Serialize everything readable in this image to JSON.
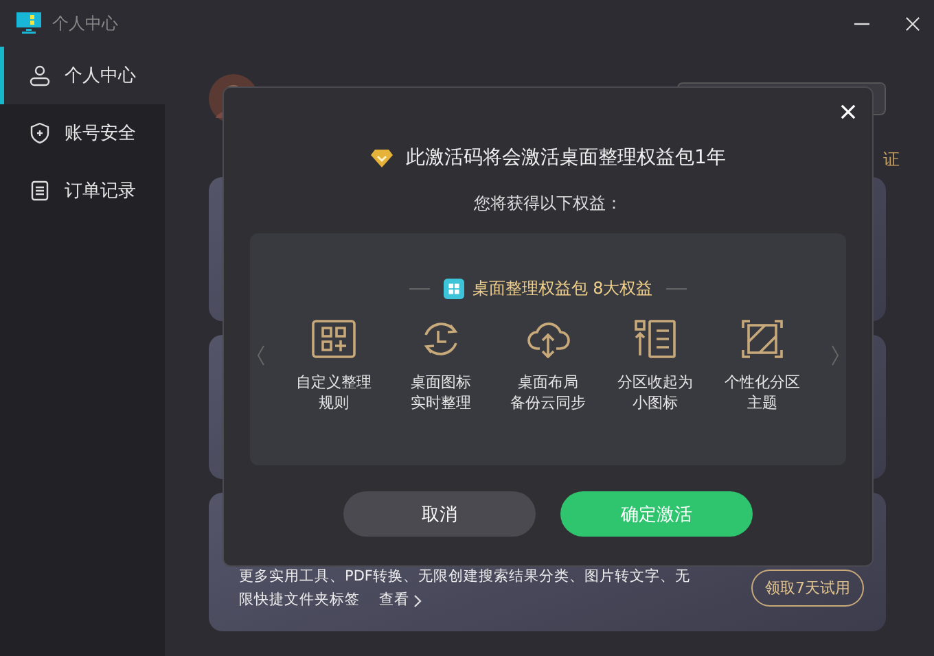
{
  "window": {
    "title": "个人中心"
  },
  "sidebar": {
    "items": [
      {
        "label": "个人中心",
        "selected": true
      },
      {
        "label": "账号安全",
        "selected": false
      },
      {
        "label": "订单记录",
        "selected": false
      }
    ]
  },
  "background": {
    "partial_text": "证",
    "promo_lines": [
      "更多实用工具、PDF转换、无限创建搜索结果分类、图片转文字、无",
      "限快捷文件夹标签"
    ],
    "promo_link": "查看",
    "trial_button": "领取7天试用"
  },
  "dialog": {
    "title": "此激活码将会激活桌面整理权益包1年",
    "subtitle": "您将获得以下权益：",
    "package_heading": "桌面整理权益包 8大权益",
    "benefits": [
      {
        "kind": "grid",
        "lines": [
          "自定义整理",
          "规则"
        ]
      },
      {
        "kind": "clock",
        "lines": [
          "桌面图标",
          "实时整理"
        ]
      },
      {
        "kind": "cloud",
        "lines": [
          "桌面布局",
          "备份云同步"
        ]
      },
      {
        "kind": "list",
        "lines": [
          "分区收起为",
          "小图标"
        ]
      },
      {
        "kind": "pattern",
        "lines": [
          "个性化分区",
          "主题"
        ]
      }
    ],
    "buttons": [
      {
        "kind": "secondary",
        "label": "取消"
      },
      {
        "kind": "primary",
        "label": "确定激活"
      }
    ]
  }
}
